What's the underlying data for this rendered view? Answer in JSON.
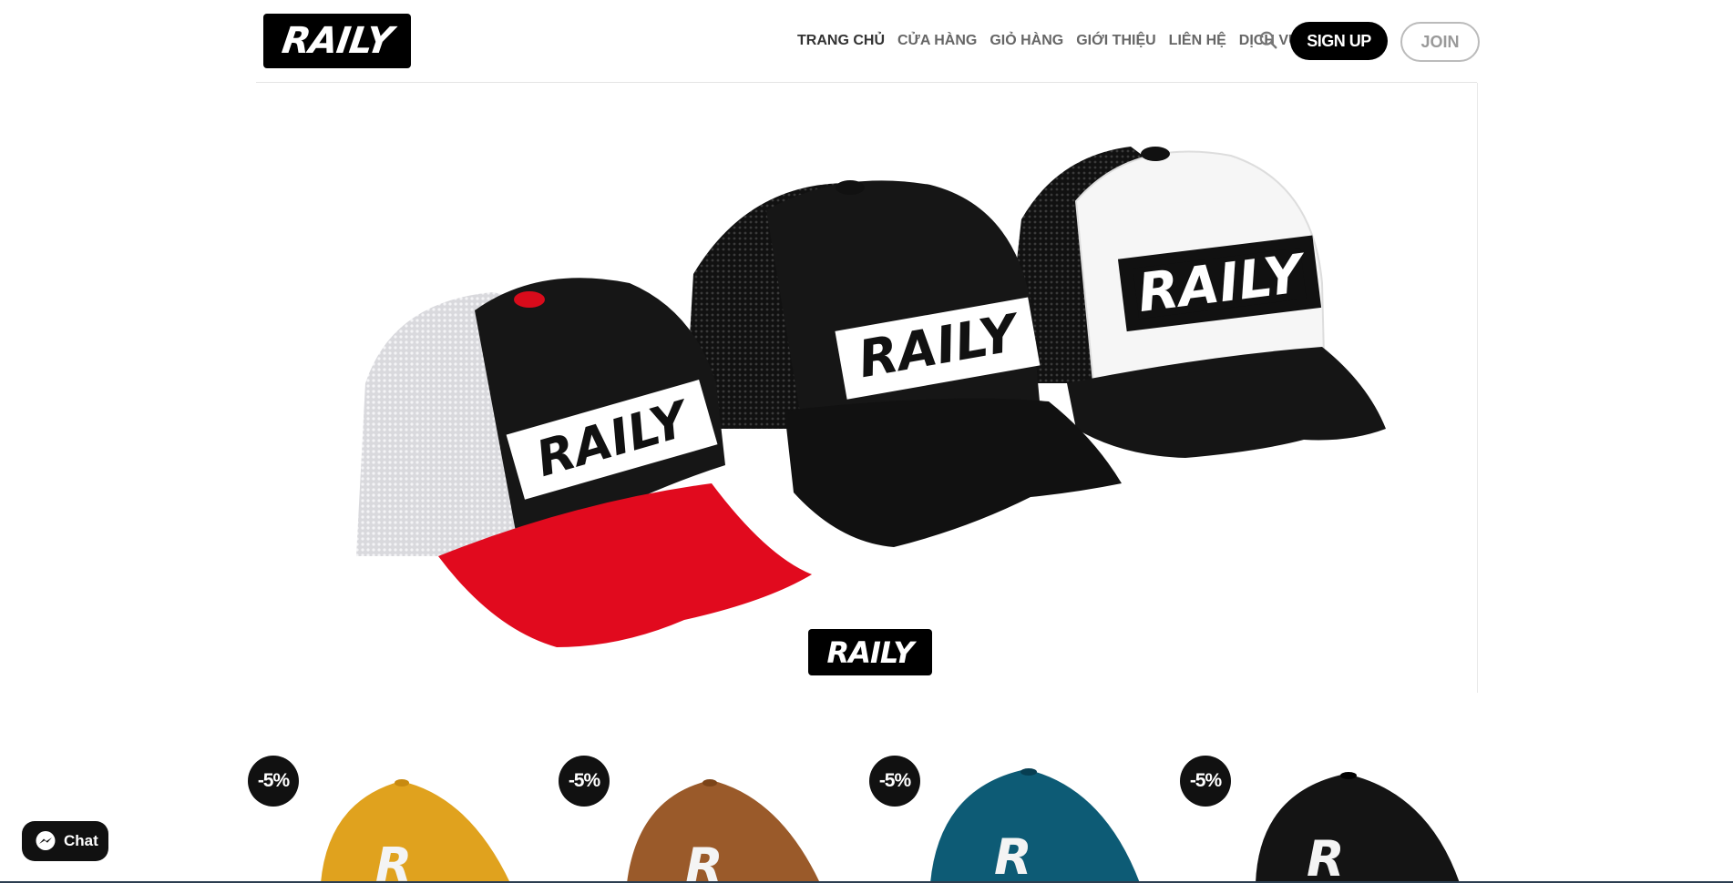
{
  "brand": {
    "logo_text": "RAILY"
  },
  "nav": {
    "items": [
      {
        "label": "TRANG CHỦ"
      },
      {
        "label": "CỬA HÀNG"
      },
      {
        "label": "GIỎ HÀNG"
      },
      {
        "label": "GIỚI THIỆU"
      },
      {
        "label": "LIÊN HỆ"
      },
      {
        "label": "DỊCH VỤ"
      }
    ]
  },
  "header": {
    "signup_label": "SIGN UP",
    "join_label": "JOIN"
  },
  "hero": {
    "cap_text": "RAILY",
    "logo_text": "RAILY"
  },
  "products": [
    {
      "badge": "-5%",
      "letter": "R",
      "color": "#e0a21e"
    },
    {
      "badge": "-5%",
      "letter": "R",
      "color": "#9a5a2a"
    },
    {
      "badge": "-5%",
      "letter": "R",
      "color": "#0d5b75"
    },
    {
      "badge": "-5%",
      "letter": "R",
      "color": "#141414"
    }
  ],
  "chat": {
    "label": "Chat"
  },
  "colors": {
    "accent": "#000000",
    "cap_red": "#e10a1e"
  }
}
